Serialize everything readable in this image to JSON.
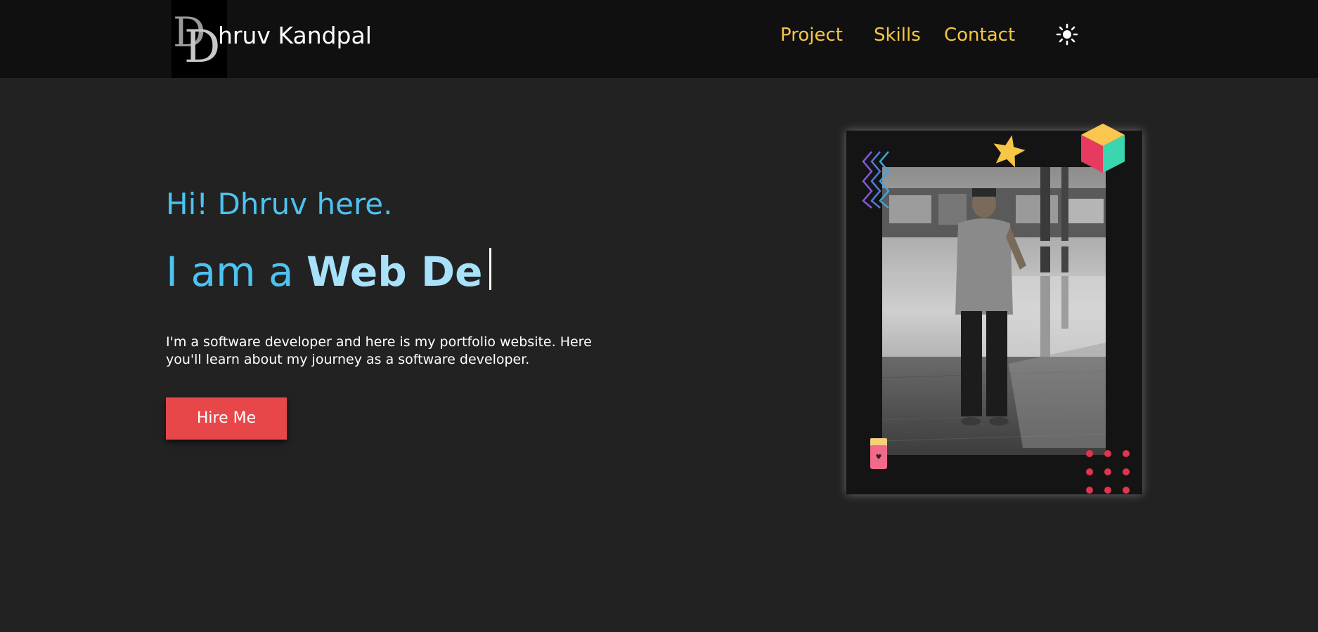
{
  "nav": {
    "logo_letters": "DD",
    "brand_name": "hruv Kandpal",
    "links": [
      "Project",
      "Skills",
      "Contact"
    ],
    "theme_icon": "sun-icon"
  },
  "hero": {
    "greeting": "Hi! Dhruv here.",
    "role_prefix": "I am a ",
    "role_typed": "Web De",
    "intro": "I'm a software developer and here is my portfolio website. Here you'll learn about my journey as a software developer.",
    "cta_label": "Hire Me"
  },
  "colors": {
    "accent_blue": "#4cc3f0",
    "nav_link": "#f6c544",
    "cta_red": "#e8474a",
    "page_bg": "#222222",
    "nav_bg": "#101010"
  },
  "photo": {
    "alt_icon": "portrait-photo"
  }
}
